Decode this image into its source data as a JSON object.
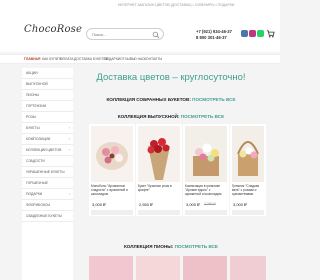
{
  "header": {
    "logo": "ChocoRose",
    "tagline": "ИНТЕРНЕТ-МАГАЗИН ЦВЕТОВ (ДОСТАВКА) • СУВЕНИРЫ • ПОДАРКИ",
    "search_placeholder": "Поиск...",
    "phone1": "+7 (921) 934-46-37",
    "phone2": "8 800 301-46-37"
  },
  "nav": {
    "items": [
      "ГЛАВНАЯ",
      "КАК КУПИТЬ",
      "ОПЛАТА",
      "ДОСТАВКА БУКЕТОВ",
      "ПОДАРКИ",
      "ОТЗЫВЫ",
      "О НАС",
      "КОНТАКТЫ"
    ]
  },
  "sidebar": {
    "items": [
      "АКЦИИ",
      "ВЫПУСКНОЙ",
      "ПИОНЫ",
      "ГОРТЕНЗИИ",
      "РОЗЫ",
      "БУКЕТЫ",
      "КОМПОЗИЦИИ",
      "КОЛЛЕКЦИИ ЦВЕТОВ",
      "СЛАДОСТИ",
      "УКРАШЕННЫЕ БУКЕТЫ",
      "ГОРШЕЧНЫЕ",
      "ПОДАРКИ",
      "ФЛОРИБОКСЫ",
      "СВАДЕБНЫЕ БУКЕТЫ"
    ]
  },
  "main": {
    "headline": "Доставка цветов – круглосуточно!",
    "collection1": {
      "title": "КОЛЛЕКЦИЯ СОБРАННЫХ БУКЕТОВ:",
      "link": "ПОСМОТРЕТЬ ВСЕ"
    },
    "collection2": {
      "title": "КОЛЛЕКЦИЯ ВЫПУСКНОЙ:",
      "link": "ПОСМОТРЕТЬ ВСЕ"
    },
    "collection3": {
      "title": "КОЛЛЕКЦИЯ ПИОНЫ:",
      "link": "ПОСМОТРЕТЬ ВСЕ"
    },
    "products": [
      {
        "name": "Моноботы \"Ароматные сладости\" с ароматной и шоколадом",
        "price": "3,000 ₽",
        "old": ""
      },
      {
        "name": "Букет \"Красные розы в крафте\"",
        "price": "2,550 ₽",
        "old": ""
      },
      {
        "name": "Композиция в гремлике \"Аромат вдоль\" с ароматной и шоколадом",
        "price": "3,000 ₽",
        "old": "2,350 ₽"
      },
      {
        "name": "Гремлик \"Сладкая вата\" с розами и хризантемами",
        "price": "3,000 ₽",
        "old": ""
      }
    ]
  },
  "colors": {
    "accent": "#3f9e8e",
    "active_nav": "#c0392b",
    "instagram": "#c13584",
    "vk": "#4a76a8",
    "whatsapp": "#25d366"
  }
}
